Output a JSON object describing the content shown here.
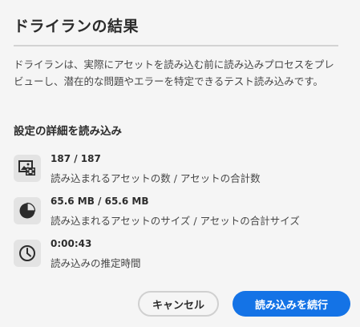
{
  "dialog": {
    "title": "ドライランの結果",
    "description": "ドライランは、実際にアセットを読み込む前に読み込みプロセスをプレビューし、潜在的な問題やエラーを特定できるテスト読み込みです。",
    "section_heading": "設定の詳細を読み込み",
    "details": [
      {
        "icon": "image-asset-icon",
        "value": "187 / 187",
        "label": "読み込まれるアセットの数 / アセットの合計数"
      },
      {
        "icon": "pie-chart-icon",
        "value": "65.6 MB / 65.6 MB",
        "label": "読み込まれるアセットのサイズ / アセットの合計サイズ"
      },
      {
        "icon": "clock-icon",
        "value": "0:00:43",
        "label": "読み込みの推定時間"
      }
    ],
    "buttons": {
      "cancel_label": "キャンセル",
      "continue_label": "読み込みを続行"
    }
  },
  "colors": {
    "primary": "#1473e6",
    "background": "#f5f5f5",
    "icon_box": "#e3e3e3"
  }
}
